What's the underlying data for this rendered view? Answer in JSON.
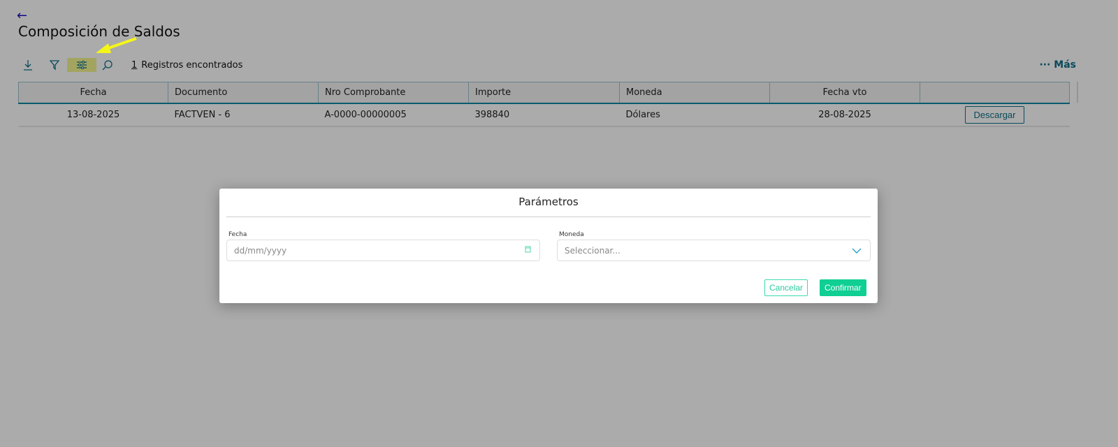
{
  "header": {
    "title": "Composición de Saldos"
  },
  "toolbar": {
    "count": "1",
    "count_label": "Registros encontrados",
    "more_label": "··· Más"
  },
  "table": {
    "columns": [
      "Fecha",
      "Documento",
      "Nro Comprobante",
      "Importe",
      "Moneda",
      "Fecha vto",
      ""
    ],
    "rows": [
      {
        "fecha": "13-08-2025",
        "documento": "FACTVEN - 6",
        "nro": "A-0000-00000005",
        "importe": "398840",
        "moneda": "Dólares",
        "fecha_vto": "28-08-2025",
        "action": "Descargar"
      }
    ]
  },
  "modal": {
    "title": "Parámetros",
    "fecha_label": "Fecha",
    "fecha_placeholder": "dd/mm/yyyy",
    "moneda_label": "Moneda",
    "moneda_placeholder": "Seleccionar...",
    "cancel": "Cancelar",
    "confirm": "Confirmar"
  },
  "colors": {
    "accent": "#0d6f86",
    "confirm": "#0fcf93",
    "highlight": "#f4f590"
  }
}
